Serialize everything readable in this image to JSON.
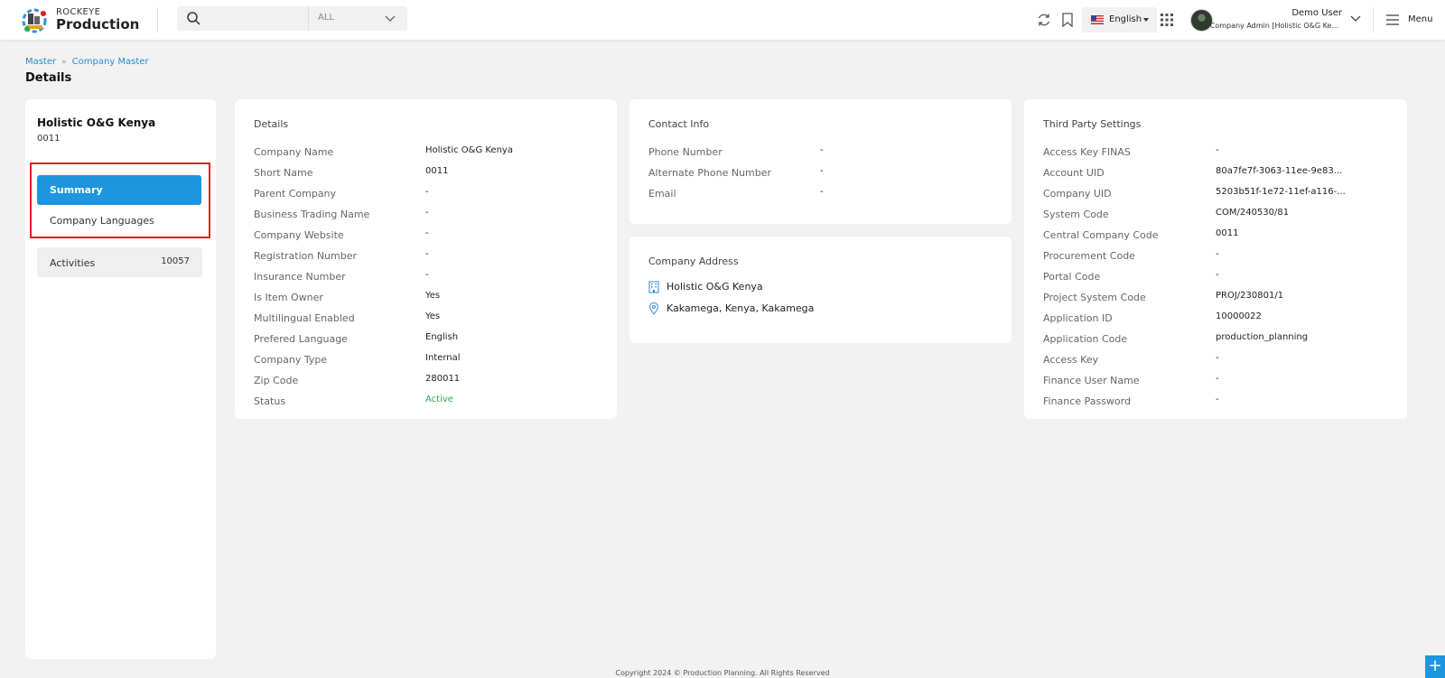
{
  "header": {
    "brand_top": "ROCKEYE",
    "brand_main": "Production",
    "search_placeholder": "",
    "search_scope": "ALL",
    "language": "English",
    "user_name": "Demo User",
    "user_role": "Company Admin [Holistic O&G Ke...",
    "menu_label": "Menu"
  },
  "breadcrumb": {
    "items": [
      "Master",
      "Company Master"
    ]
  },
  "page_title": "Details",
  "sidebar": {
    "company_name": "Holistic O&G Kenya",
    "company_code": "0011",
    "nav": [
      "Summary",
      "Company Languages"
    ],
    "activities_label": "Activities",
    "activities_count": "10057"
  },
  "details": {
    "title": "Details",
    "rows": [
      {
        "label": "Company Name",
        "value": "Holistic O&G Kenya"
      },
      {
        "label": "Short Name",
        "value": "0011"
      },
      {
        "label": "Parent Company",
        "value": "-"
      },
      {
        "label": "Business Trading Name",
        "value": "-"
      },
      {
        "label": "Company Website",
        "value": "-"
      },
      {
        "label": "Registration Number",
        "value": "-"
      },
      {
        "label": "Insurance Number",
        "value": "-"
      },
      {
        "label": "Is Item Owner",
        "value": "Yes"
      },
      {
        "label": "Multilingual Enabled",
        "value": "Yes"
      },
      {
        "label": "Prefered Language",
        "value": "English"
      },
      {
        "label": "Company Type",
        "value": "Internal"
      },
      {
        "label": "Zip Code",
        "value": "280011"
      },
      {
        "label": "Status",
        "value": "Active"
      }
    ]
  },
  "contact": {
    "title": "Contact Info",
    "rows": [
      {
        "label": "Phone Number",
        "value": "-"
      },
      {
        "label": "Alternate Phone Number",
        "value": "-"
      },
      {
        "label": "Email",
        "value": "-"
      }
    ]
  },
  "address": {
    "title": "Company Address",
    "name": "Holistic O&G Kenya",
    "location": "Kakamega, Kenya, Kakamega"
  },
  "third_party": {
    "title": "Third Party Settings",
    "rows": [
      {
        "label": "Access Key FINAS",
        "value": "-"
      },
      {
        "label": "Account UID",
        "value": "80a7fe7f-3063-11ee-9e83..."
      },
      {
        "label": "Company UID",
        "value": "5203b51f-1e72-11ef-a116-..."
      },
      {
        "label": "System Code",
        "value": "COM/240530/81"
      },
      {
        "label": "Central Company Code",
        "value": "0011"
      },
      {
        "label": "Procurement Code",
        "value": "-"
      },
      {
        "label": "Portal Code",
        "value": "-"
      },
      {
        "label": "Project System Code",
        "value": "PROJ/230801/1"
      },
      {
        "label": "Application ID",
        "value": "10000022"
      },
      {
        "label": "Application Code",
        "value": "production_planning"
      },
      {
        "label": "Access Key",
        "value": "-"
      },
      {
        "label": "Finance User Name",
        "value": "-"
      },
      {
        "label": "Finance Password",
        "value": "-"
      }
    ]
  },
  "footer": "Copyright 2024 © Production Planning. All Rights Reserved",
  "fab_label": "+",
  "colors": {
    "accent": "#1f95e0",
    "highlight_border": "#e02020",
    "status_active": "#2ea84a"
  }
}
